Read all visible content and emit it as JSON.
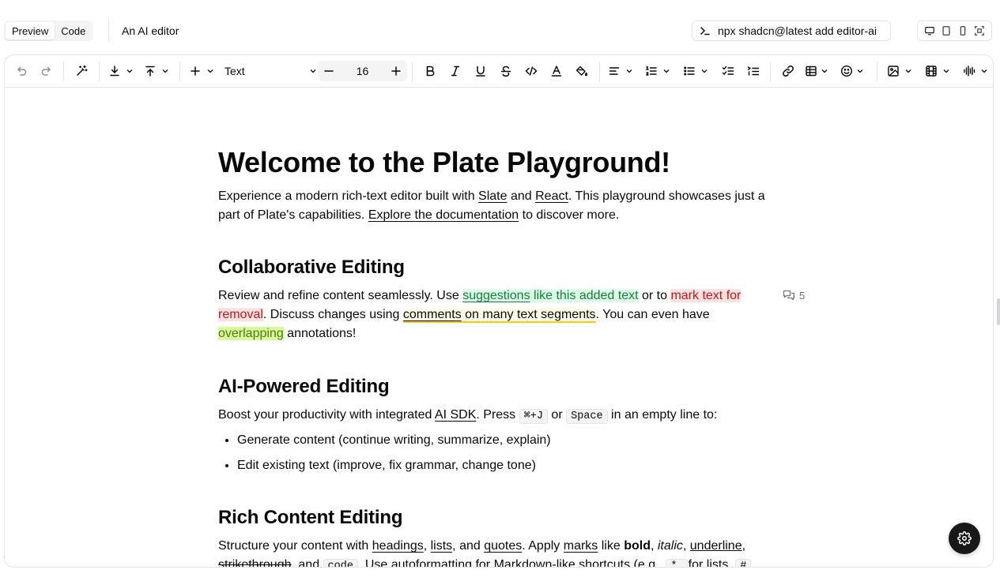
{
  "header": {
    "tabs": [
      "Preview",
      "Code"
    ],
    "active_tab": "Preview",
    "title": "An AI editor",
    "command": "npx shadcn@latest add editor-ai",
    "device_icons": [
      "desktop-icon",
      "tablet-icon",
      "mobile-icon",
      "fullscreen-icon"
    ]
  },
  "toolbar": {
    "turn_into": "Text",
    "font_size": "16",
    "icons": [
      "undo-icon",
      "redo-icon",
      "ai-wand-icon",
      "import-icon",
      "export-icon",
      "insert-plus-icon",
      "font-size-minus-icon",
      "font-size-plus-icon",
      "bold-icon",
      "italic-icon",
      "underline-icon",
      "strikethrough-icon",
      "code-icon",
      "text-color-icon",
      "highlight-icon",
      "align-icon",
      "numbered-list-icon",
      "bulleted-list-icon",
      "todo-list-icon",
      "toggle-list-icon",
      "link-icon",
      "table-icon",
      "emoji-icon",
      "image-icon",
      "video-icon",
      "audio-icon"
    ]
  },
  "doc": {
    "h1": "Welcome to the Plate Playground!",
    "intro": {
      "t1": "Experience a modern rich-text editor built with ",
      "l1": "Slate",
      "t2": " and ",
      "l2": "React",
      "t3": ". This playground showcases just a part of Plate's capabilities. ",
      "l3": "Explore the documentation",
      "t4": " to discover more."
    },
    "collab": {
      "h2": "Collaborative Editing",
      "t1": "Review and refine content seamlessly. Use ",
      "s1": "suggestions",
      "s2": " like this added text",
      "t2": " or to ",
      "r1": "mark text for removal",
      "t3": ". Discuss changes using ",
      "c1": "comments",
      "c2": " on many text segments",
      "t4": ". You can even have ",
      "o1": "overlapping",
      "t5": " annotations!",
      "comment_count": "5"
    },
    "ai": {
      "h2": "AI-Powered Editing",
      "t1": "Boost your productivity with integrated ",
      "l1": "AI SDK",
      "t2": ". Press ",
      "k1": "⌘+J",
      "t3": " or ",
      "k2": "Space",
      "t4": " in an empty line to:",
      "bullets": [
        "Generate content (continue writing, summarize, explain)",
        "Edit existing text (improve, fix grammar, change tone)"
      ]
    },
    "rich": {
      "h2": "Rich Content Editing",
      "t1": "Structure your content with ",
      "l1": "headings",
      "t2": ", ",
      "l2": "lists",
      "t3": ", and ",
      "l3": "quotes",
      "t4": ". Apply ",
      "l4": "marks",
      "t5": " like ",
      "b": "bold",
      "t6": ", ",
      "i": "italic",
      "t7": ", ",
      "u": "underline",
      "t8": ",",
      "s": "strikethrough",
      "t9": ", and ",
      "code": "code",
      "t10": ". Use ",
      "l5": "autoformatting",
      "t11": " for Markdown-like shortcuts (e.g., ",
      "k1": "* ",
      "t12": " for lists, ",
      "k2": "# "
    }
  }
}
